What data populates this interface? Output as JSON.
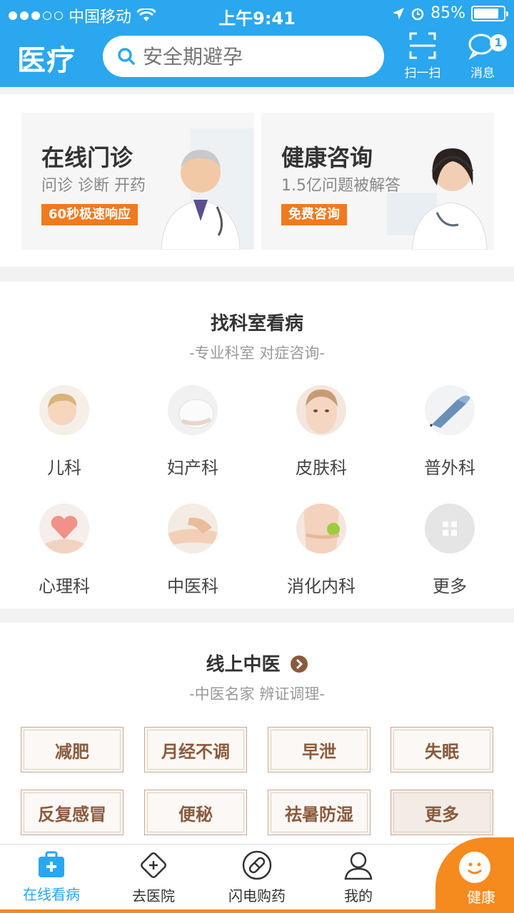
{
  "status_bar": {
    "carrier": "中国移动",
    "time": "上午9:41",
    "battery": "85%",
    "battery_level": 0.85
  },
  "header": {
    "logo": "医疗",
    "search_placeholder": "安全期避孕",
    "scan_label": "扫一扫",
    "message_label": "消息",
    "message_badge": "1"
  },
  "promo": {
    "cards": [
      {
        "title": "在线门诊",
        "subtitle": "问诊 诊断 开药",
        "tag": "60秒极速响应"
      },
      {
        "title": "健康咨询",
        "subtitle": "1.5亿问题被解答",
        "tag": "免费咨询"
      }
    ]
  },
  "departments": {
    "title": "找科室看病",
    "subtitle": "-专业科室 对症咨询-",
    "items": [
      {
        "label": "儿科",
        "icon": "child-icon"
      },
      {
        "label": "妇产科",
        "icon": "pregnancy-icon"
      },
      {
        "label": "皮肤科",
        "icon": "skin-icon"
      },
      {
        "label": "普外科",
        "icon": "surgery-icon"
      },
      {
        "label": "心理科",
        "icon": "heart-icon"
      },
      {
        "label": "中医科",
        "icon": "pulse-icon"
      },
      {
        "label": "消化内科",
        "icon": "stomach-icon"
      },
      {
        "label": "更多",
        "icon": "grid-icon"
      }
    ]
  },
  "tcm": {
    "title": "线上中医",
    "subtitle": "-中医名家 辨证调理-",
    "items": [
      "减肥",
      "月经不调",
      "早泄",
      "失眠",
      "反复感冒",
      "便秘",
      "祛暑防湿",
      "更多"
    ]
  },
  "tabbar": {
    "tabs": [
      {
        "label": "在线看病",
        "icon": "medkit-icon",
        "active": true
      },
      {
        "label": "去医院",
        "icon": "hospital-icon",
        "active": false
      },
      {
        "label": "闪电购药",
        "icon": "pill-icon",
        "active": false
      },
      {
        "label": "我的",
        "icon": "user-icon",
        "active": false
      },
      {
        "label": "健康",
        "icon": "smile-icon",
        "active": false
      }
    ]
  },
  "colors": {
    "primary": "#2aa7ee",
    "accent": "#f58a1f",
    "tcm_text": "#8a5a3c"
  }
}
